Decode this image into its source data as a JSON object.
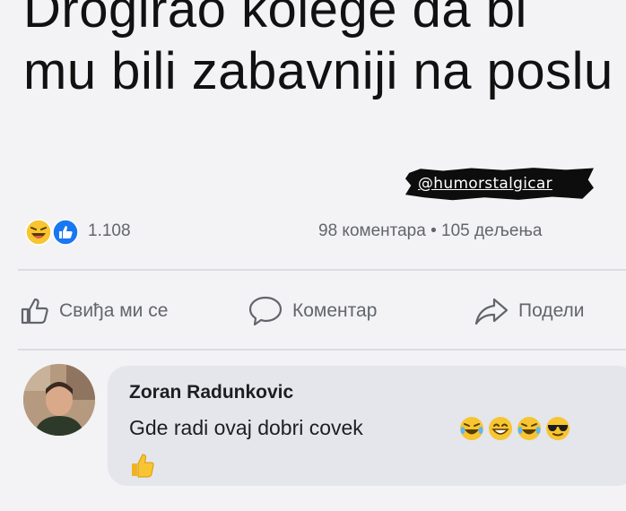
{
  "post": {
    "headline": "Drogirao kolege da bi mu bili zabavniji na poslu"
  },
  "watermark": "@humorstalgicar",
  "stats": {
    "reaction_icons": [
      "laugh-emoji-icon",
      "like-reaction-icon"
    ],
    "reaction_count": "1.108",
    "comments_shares": "98 коментара • 105 дељења"
  },
  "actions": {
    "like": "Свиђа ми се",
    "comment": "Коментар",
    "share": "Подели"
  },
  "comment": {
    "author": "Zoran Radunkovic",
    "text": "Gde radi ovaj dobri covek",
    "emojis": [
      "rolling-laugh-emoji-icon",
      "grin-emoji-icon",
      "rolling-laugh-emoji-icon",
      "sunglasses-emoji-icon"
    ],
    "extra_emoji": "thumbs-up-emoji-icon"
  },
  "colors": {
    "background": "#f3f3f5",
    "bubble": "#e4e6eb",
    "secondary_text": "#62656b",
    "like_blue": "#1877f2",
    "emoji_yellow": "#f7c531"
  }
}
